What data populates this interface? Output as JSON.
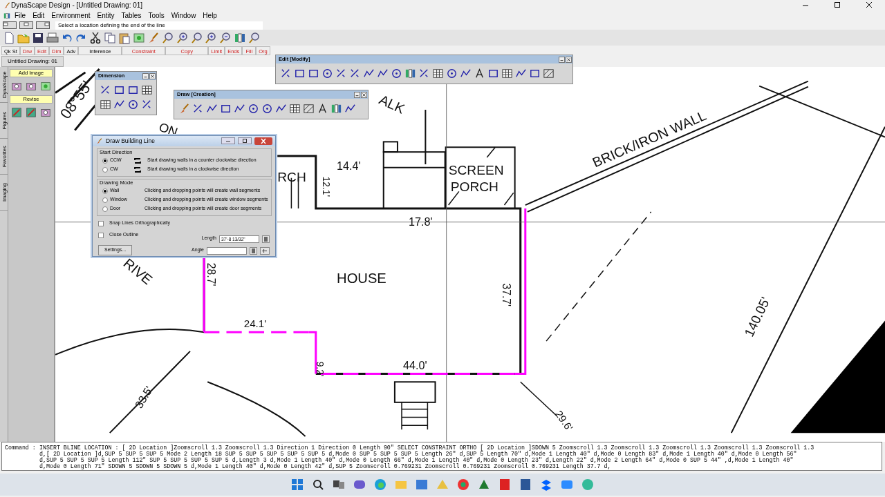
{
  "window": {
    "title": "DynaScape Design  - [Untitled Drawing: 01]"
  },
  "menu": [
    "File",
    "Edit",
    "Environment",
    "Entity",
    "Tables",
    "Tools",
    "Window",
    "Help"
  ],
  "prompt": "Select a location defining the end of the line",
  "toolbar_labels": [
    {
      "label": "Qk St",
      "kind": "group"
    },
    {
      "label": "Drw",
      "kind": "command"
    },
    {
      "label": "Edit",
      "kind": "command"
    },
    {
      "label": "Dim",
      "kind": "command"
    },
    {
      "label": "Adv",
      "kind": "group"
    },
    {
      "label": "Inference",
      "kind": "group"
    },
    {
      "label": "Constraint",
      "kind": "command"
    },
    {
      "label": "Copy",
      "kind": "command"
    },
    {
      "label": "Limit",
      "kind": "command"
    },
    {
      "label": "Ends",
      "kind": "command"
    },
    {
      "label": "Fill",
      "kind": "command"
    },
    {
      "label": "Org",
      "kind": "command"
    }
  ],
  "document_tab": "Untitled Drawing: 01",
  "side_tabs": [
    "DynaScape",
    "Figures",
    "Favorites",
    "Imaging"
  ],
  "side_panel": {
    "sections": [
      "Add Image",
      "Revise"
    ]
  },
  "palettes": [
    {
      "title": "Dimension"
    },
    {
      "title": "Draw [Creation]"
    },
    {
      "title": "Edit [Modify]"
    }
  ],
  "dialog": {
    "title": "Draw Building Line",
    "groups": [
      {
        "title": "Start Direction",
        "kind": "direction",
        "options": [
          {
            "label": "CCW",
            "description": "Start drawing walls in a counter clockwise direction",
            "selected": true
          },
          {
            "label": "CW",
            "description": "Start drawing walls in a clockwise direction",
            "selected": false
          }
        ]
      },
      {
        "title": "Drawing Mode",
        "kind": "mode",
        "options": [
          {
            "label": "Wall",
            "description": "Clicking and dropping points will create wall segments",
            "selected": true
          },
          {
            "label": "Window",
            "description": "Clicking and dropping points will create window segments",
            "selected": false
          },
          {
            "label": "Door",
            "description": "Clicking and dropping points will create door segments",
            "selected": false
          }
        ]
      }
    ],
    "checkboxes": [
      {
        "label": "Snap Lines Orthographically",
        "checked": false
      },
      {
        "label": "Close Outline",
        "checked": false
      }
    ],
    "fields": [
      {
        "label": "Length",
        "value": "37'-8 13/32\""
      },
      {
        "label": "Angle"
      }
    ],
    "button": "Settings..."
  },
  "drawing_labels": [
    "08°55'",
    "ALK",
    "ON",
    "BRICK/IRON WALL",
    "SCREEN",
    "PORCH",
    "14.4'",
    "RCH",
    "12.1'",
    "17.8'",
    "HOUSE",
    "28.7'",
    "37.7'",
    "24.1'",
    "9.2'",
    "44.0'",
    "140.05'",
    "33.5'",
    "29.6'",
    "RIVE"
  ],
  "command": {
    "label": "Command :",
    "lines": [
      "INSERT BLINE LOCATION : [ 2D Location ]Zoomscroll 1.3 Zoomscroll 1.3 Direction 1 Direction 0 Length 90\" SELECT CONSTRAINT ORTHO [ 2D Location ]SDOWN 5 Zoomscroll 1.3 Zoomscroll 1.3 Zoomscroll 1.3 Zoomscroll 1.3 Zoomscroll 1.3",
      "d,[ 2D Location ]d,SUP 5 SUP 5 SUP 5 Mode 2 Length 18 SUP 5 SUP 5 SUP 5 SUP 5 SUP 5 d,Mode 0 SUP 5 SUP 5 SUP 5 Length 26\" d,SUP 5 Length 70\" d,Mode 1 Length 40\" d,Mode 0 Length 83\" d,Mode 1 Length 40\" d,Mode 0 Length 56\"",
      "d,SUP 5 SUP 5 SUP 5 Length 112\" SUP 5 SUP 5 SUP 5 SUP 5 d,Length 3 d,Mode 1 Length 40\" d,Mode 0 Length 66\" d,Mode 1 Length 40\" d,Mode 0 Length 23\" d,Length 22\" d,Mode 2 Length 64\" d,Mode 0 SUP 5 44\" ,d,Mode 1 Length 40\"",
      "d,Mode 0 Length 71\" SDOWN 5 SDOWN 5 SDOWN 5 d,Mode 1 Length 40\" d,Mode 0 Length 42\" d,SUP 5 Zoomscroll 0.769231 Zoomscroll 0.769231 Zoomscroll 0.769231 Length 37.7 d,"
    ]
  }
}
